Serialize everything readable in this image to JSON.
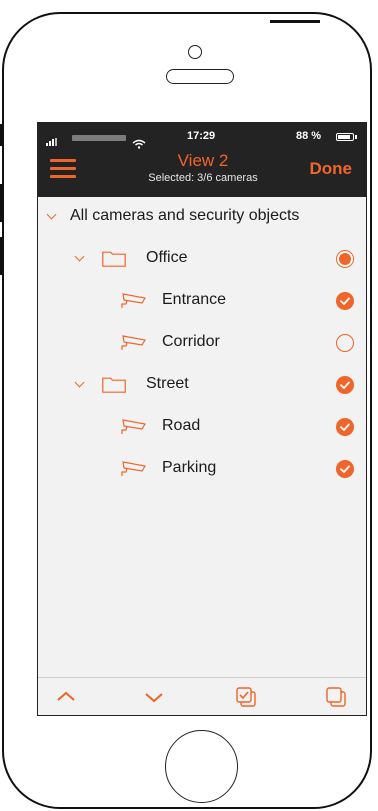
{
  "status_bar": {
    "time": "17:29",
    "battery": "88 %",
    "battery_fraction": 0.88
  },
  "header": {
    "title": "View 2",
    "subtitle": "Selected: 3/6 cameras",
    "done_label": "Done"
  },
  "tree": {
    "items": [
      {
        "label": "All cameras and security objects",
        "level": 0,
        "type": "root"
      },
      {
        "label": "Office",
        "level": 1,
        "type": "folder",
        "selection": "partial"
      },
      {
        "label": "Entrance",
        "level": 2,
        "type": "camera",
        "selection": "checked"
      },
      {
        "label": "Corridor",
        "level": 2,
        "type": "camera",
        "selection": "unchecked"
      },
      {
        "label": "Street",
        "level": 1,
        "type": "folder",
        "selection": "checked"
      },
      {
        "label": "Road",
        "level": 2,
        "type": "camera",
        "selection": "checked"
      },
      {
        "label": "Parking",
        "level": 2,
        "type": "camera",
        "selection": "checked"
      }
    ]
  },
  "colors": {
    "accent": "#f06529",
    "header_bg": "#232323",
    "screen_bg": "#f2f2f2"
  },
  "icons": {
    "menu": "menu-icon",
    "chevron": "chevron-down-icon",
    "folder": "folder-icon",
    "camera": "camera-icon",
    "scroll_up": "chevron-up-icon",
    "scroll_down": "chevron-down-icon",
    "select_all": "select-all-icon",
    "deselect_all": "deselect-all-icon"
  }
}
